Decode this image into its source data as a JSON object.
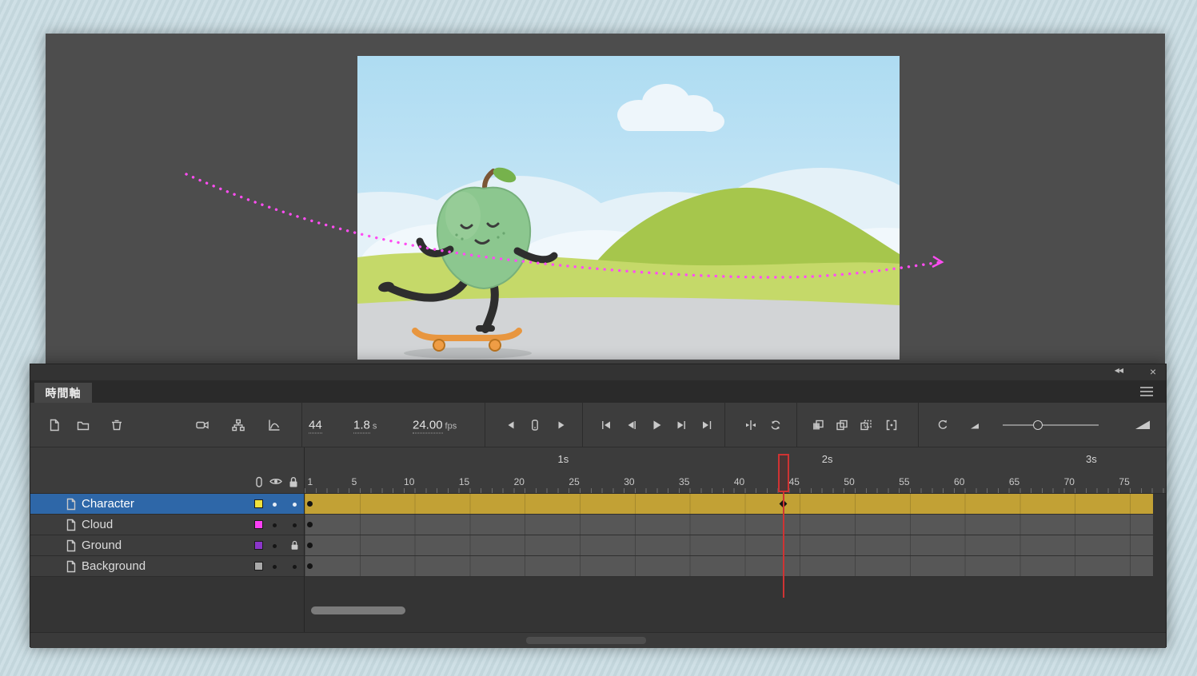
{
  "window": {
    "collapse_label": "◀◀",
    "close_label": "×"
  },
  "panel": {
    "tab_label": "時間軸"
  },
  "toolbar": {
    "current_frame": "44",
    "elapsed_time": "1.8",
    "elapsed_time_unit": "s",
    "frame_rate": "24.00",
    "frame_rate_unit": "fps",
    "icon_names": [
      "new-layer",
      "new-folder",
      "delete-layer",
      "add-camera",
      "show-parenting-view",
      "graph-editor",
      "step-back-one-frame",
      "current-frame-indicator",
      "step-forward-one-frame",
      "go-to-first-frame",
      "previous-frame",
      "play",
      "next-frame",
      "go-to-last-frame",
      "center-playhead",
      "loop-playback",
      "onion-skin",
      "onion-skin-outlines",
      "edit-multiple-frames",
      "modify-frame-markers",
      "reset-timeline-zoom",
      "zoom-out",
      "timeline-zoom-slider",
      "zoom-in"
    ]
  },
  "ruler": {
    "playhead_frame": 44,
    "seconds_labels": [
      {
        "text": "1s",
        "frame": 24
      },
      {
        "text": "2s",
        "frame": 48
      },
      {
        "text": "3s",
        "frame": 72
      }
    ],
    "frame_labels": [
      {
        "text": "1",
        "frame": 1
      },
      {
        "text": "5",
        "frame": 5
      },
      {
        "text": "10",
        "frame": 10
      },
      {
        "text": "15",
        "frame": 15
      },
      {
        "text": "20",
        "frame": 20
      },
      {
        "text": "25",
        "frame": 25
      },
      {
        "text": "30",
        "frame": 30
      },
      {
        "text": "35",
        "frame": 35
      },
      {
        "text": "40",
        "frame": 40
      },
      {
        "text": "45",
        "frame": 45
      },
      {
        "text": "50",
        "frame": 50
      },
      {
        "text": "55",
        "frame": 55
      },
      {
        "text": "60",
        "frame": 60
      },
      {
        "text": "65",
        "frame": 65
      },
      {
        "text": "70",
        "frame": 70
      },
      {
        "text": "75",
        "frame": 75
      }
    ]
  },
  "layers": [
    {
      "name": "Character",
      "swatch": "#f0e13c",
      "selected": true,
      "locked": false,
      "span": "tween",
      "keyframes": [
        1
      ],
      "property_keyframes": [
        44
      ]
    },
    {
      "name": "Cloud",
      "swatch": "#fb3ff5",
      "selected": false,
      "locked": false,
      "span": "static",
      "keyframes": [
        1
      ],
      "property_keyframes": []
    },
    {
      "name": "Ground",
      "swatch": "#8b36c9",
      "selected": false,
      "locked": true,
      "span": "static",
      "keyframes": [
        1
      ],
      "property_keyframes": []
    },
    {
      "name": "Background",
      "swatch": "#a9a9a9",
      "selected": false,
      "locked": false,
      "span": "static",
      "keyframes": [
        1
      ],
      "property_keyframes": []
    }
  ],
  "colors": {
    "selection_blue": "#2e67a8",
    "tween_span_yellow": "#c2a135",
    "playhead_red": "#cf3333",
    "motion_path_magenta": "#ff4df2"
  },
  "scene": {
    "objects": [
      "sky",
      "clouds",
      "hill",
      "field",
      "ground",
      "apple-character",
      "skateboard",
      "motion-path"
    ]
  }
}
